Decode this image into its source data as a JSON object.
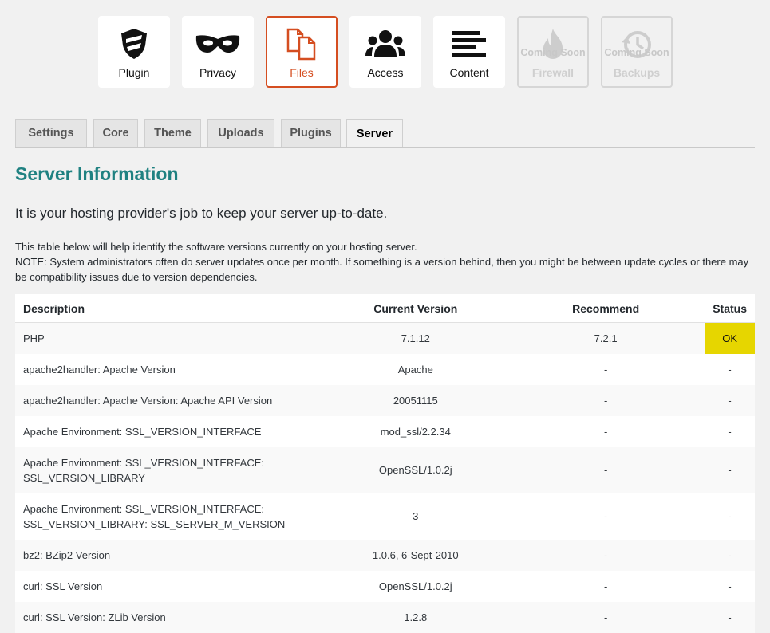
{
  "nav_tiles": [
    {
      "id": "plugin",
      "label": "Plugin",
      "icon": "shield-icon",
      "state": "normal"
    },
    {
      "id": "privacy",
      "label": "Privacy",
      "icon": "mask-icon",
      "state": "normal"
    },
    {
      "id": "files",
      "label": "Files",
      "icon": "files-icon",
      "state": "active"
    },
    {
      "id": "access",
      "label": "Access",
      "icon": "users-icon",
      "state": "normal"
    },
    {
      "id": "content",
      "label": "Content",
      "icon": "lines-icon",
      "state": "normal"
    },
    {
      "id": "firewall",
      "label": "Firewall",
      "icon": "flame-icon",
      "state": "disabled",
      "badge": "Coming Soon"
    },
    {
      "id": "backups",
      "label": "Backups",
      "icon": "history-icon",
      "state": "disabled",
      "badge": "Coming Soon"
    }
  ],
  "tabs": [
    {
      "label": "Settings",
      "active": false
    },
    {
      "label": "Core",
      "active": false
    },
    {
      "label": "Theme",
      "active": false
    },
    {
      "label": "Uploads",
      "active": false
    },
    {
      "label": "Plugins",
      "active": false
    },
    {
      "label": "Server",
      "active": true
    }
  ],
  "page": {
    "title": "Server Information",
    "subheading": "It is your hosting provider's job to keep your server up-to-date.",
    "note_line1": "This table below will help identify the software versions currently on your hosting server.",
    "note_line2": "NOTE: System administrators often do server updates once per month. If something is a version behind, then you might be between update cycles or there may be compatibility issues due to version dependencies."
  },
  "table": {
    "headers": {
      "description": "Description",
      "current": "Current Version",
      "recommend": "Recommend",
      "status": "Status"
    },
    "rows": [
      {
        "description": [
          "PHP"
        ],
        "current": "7.1.12",
        "recommend": "7.2.1",
        "status": "OK"
      },
      {
        "description": [
          "apache2handler: Apache Version"
        ],
        "current": "Apache",
        "recommend": "-",
        "status": "-"
      },
      {
        "description": [
          "apache2handler: Apache Version: Apache API Version"
        ],
        "current": "20051115",
        "recommend": "-",
        "status": "-"
      },
      {
        "description": [
          "Apache Environment: SSL_VERSION_INTERFACE"
        ],
        "current": "mod_ssl/2.2.34",
        "recommend": "-",
        "status": "-"
      },
      {
        "description": [
          "Apache Environment: SSL_VERSION_INTERFACE:",
          "SSL_VERSION_LIBRARY"
        ],
        "current": "OpenSSL/1.0.2j",
        "recommend": "-",
        "status": "-"
      },
      {
        "description": [
          "Apache Environment: SSL_VERSION_INTERFACE:",
          "SSL_VERSION_LIBRARY: SSL_SERVER_M_VERSION"
        ],
        "current": "3",
        "recommend": "-",
        "status": "-"
      },
      {
        "description": [
          "bz2: BZip2 Version"
        ],
        "current": "1.0.6, 6-Sept-2010",
        "recommend": "-",
        "status": "-"
      },
      {
        "description": [
          "curl: SSL Version"
        ],
        "current": "OpenSSL/1.0.2j",
        "recommend": "-",
        "status": "-"
      },
      {
        "description": [
          "curl: SSL Version: ZLib Version"
        ],
        "current": "1.2.8",
        "recommend": "-",
        "status": "-"
      }
    ]
  },
  "colors": {
    "accent_active": "#d54e21",
    "title": "#1f8181",
    "status_ok": "#e6d600"
  }
}
